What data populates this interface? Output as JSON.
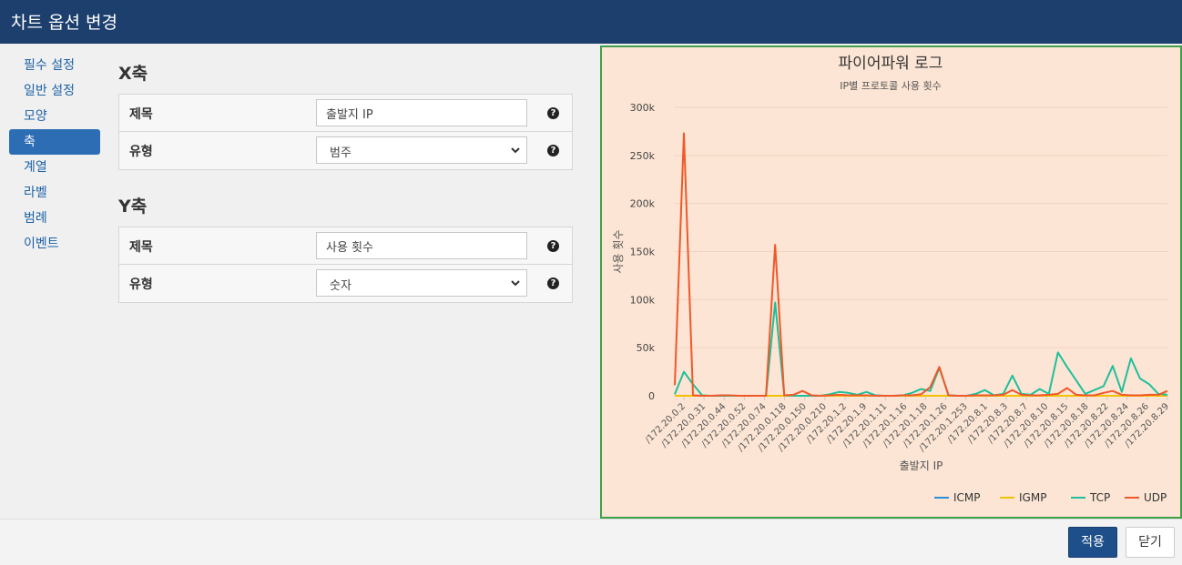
{
  "window": {
    "title": "차트 옵션 변경"
  },
  "sidebar": {
    "items": [
      {
        "label": "필수 설정"
      },
      {
        "label": "일반 설정"
      },
      {
        "label": "모양"
      },
      {
        "label": "축"
      },
      {
        "label": "계열"
      },
      {
        "label": "라벨"
      },
      {
        "label": "범례"
      },
      {
        "label": "이벤트"
      }
    ],
    "active_index": 3
  },
  "x_axis": {
    "heading": "X축",
    "title_label": "제목",
    "title_value": "출발지 IP",
    "type_label": "유형",
    "type_value": "범주"
  },
  "y_axis": {
    "heading": "Y축",
    "title_label": "제목",
    "title_value": "사용 횟수",
    "type_label": "유형",
    "type_value": "숫자"
  },
  "help_glyph": "?",
  "footer": {
    "apply_label": "적용",
    "close_label": "닫기"
  },
  "colors": {
    "ICMP": "#2b8fd9",
    "IGMP": "#f2c200",
    "TCP": "#1fbf9a",
    "UDP": "#f0582a",
    "chart_bg": "#fce5d4",
    "chart_border": "#3fa04a",
    "header": "#1c3f6e"
  },
  "chart_data": {
    "type": "line",
    "title": "파이어파워 로그",
    "subtitle": "IP별 프로토콜 사용 횟수",
    "xlabel": "출발지 IP",
    "ylabel": "사용 횟수",
    "ylim": [
      0,
      300000
    ],
    "yticks": [
      0,
      50000,
      100000,
      150000,
      200000,
      250000,
      300000
    ],
    "ytick_labels": [
      "0",
      "50k",
      "100k",
      "150k",
      "200k",
      "250k",
      "300k"
    ],
    "x_tick_labels": [
      "/172.20.0.2",
      "/172.20.0.31",
      "/172.20.0.44",
      "/172.20.0.52",
      "/172.20.0.74",
      "/172.20.0.118",
      "/172.20.0.150",
      "/172.20.0.210",
      "/172.20.1.2",
      "/172.20.1.9",
      "/172.20.1.11",
      "/172.20.1.16",
      "/172.20.1.18",
      "/172.20.1.26",
      "/172.20.1.253",
      "/172.20.8.1",
      "/172.20.8.3",
      "/172.20.8.7",
      "/172.20.8.10",
      "/172.20.8.15",
      "/172.20.8.18",
      "/172.20.8.22",
      "/172.20.8.24",
      "/172.20.8.26",
      "/172.20.8.29"
    ],
    "legend_position": "bottom-right",
    "grid": true,
    "series": [
      {
        "name": "ICMP",
        "values": [
          0,
          0,
          0,
          0,
          0,
          0,
          0,
          0,
          0,
          0,
          0,
          0,
          0,
          0,
          0,
          0,
          0,
          0,
          0,
          0,
          0,
          0,
          0,
          0,
          0,
          0,
          0,
          0,
          0,
          0,
          0,
          0,
          0,
          0,
          0,
          0,
          0,
          0,
          0,
          0,
          0,
          0,
          0,
          0,
          0,
          0,
          0,
          0,
          0,
          0,
          0,
          0,
          0,
          0,
          0
        ]
      },
      {
        "name": "IGMP",
        "values": [
          0,
          0,
          0,
          0,
          0,
          0,
          0,
          0,
          0,
          0,
          0,
          0,
          0,
          0,
          0,
          0,
          0,
          0,
          0,
          0,
          0,
          0,
          0,
          0,
          0,
          0,
          0,
          0,
          0,
          0,
          0,
          0,
          0,
          0,
          0,
          0,
          0,
          0,
          0,
          0,
          0,
          0,
          0,
          0,
          0,
          0,
          0,
          0,
          0,
          0,
          0,
          0,
          0,
          0,
          0
        ]
      },
      {
        "name": "TCP",
        "values": [
          1500,
          25000,
          12000,
          500,
          0,
          0,
          0,
          0,
          0,
          0,
          0,
          97000,
          500,
          0,
          0,
          0,
          0,
          1500,
          4000,
          3000,
          1000,
          4000,
          500,
          0,
          0,
          500,
          3000,
          7000,
          5000,
          29000,
          500,
          0,
          0,
          2000,
          6000,
          500,
          2000,
          21000,
          2000,
          1000,
          7000,
          2000,
          45000,
          30000,
          16000,
          2000,
          6000,
          10000,
          31000,
          4000,
          39000,
          18000,
          12000,
          2000,
          1000
        ]
      },
      {
        "name": "UDP",
        "values": [
          11000,
          273000,
          500,
          0,
          0,
          500,
          500,
          0,
          0,
          0,
          0,
          157000,
          500,
          1000,
          5000,
          500,
          0,
          500,
          1000,
          500,
          500,
          500,
          0,
          0,
          0,
          500,
          500,
          1500,
          9000,
          30000,
          500,
          0,
          0,
          500,
          500,
          500,
          1000,
          6000,
          1000,
          500,
          500,
          1000,
          2000,
          8000,
          1000,
          500,
          500,
          3000,
          5000,
          1000,
          500,
          500,
          1000,
          1000,
          5000
        ]
      }
    ]
  }
}
